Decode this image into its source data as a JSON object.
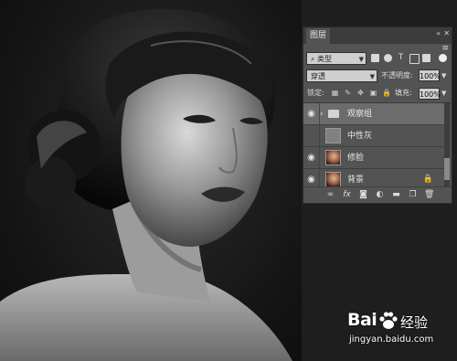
{
  "panel": {
    "tab_label": "图层",
    "collapse_control": "«",
    "close_control": "✕",
    "menu_icon": "≡",
    "filter": {
      "type_label": "类型",
      "search_glyph": "⌕"
    },
    "blend_mode": "穿透",
    "opacity_label": "不透明度:",
    "opacity_value": "100%",
    "lock_label": "锁定:",
    "fill_label": "填充:",
    "fill_value": "100%",
    "layers": [
      {
        "name": "观察组",
        "type": "group",
        "visible": true,
        "selected": true
      },
      {
        "name": "中性灰",
        "type": "gray-fill",
        "visible": false,
        "selected": false
      },
      {
        "name": "修脸",
        "type": "photo",
        "visible": true,
        "selected": false
      },
      {
        "name": "背景",
        "type": "photo",
        "visible": true,
        "selected": false,
        "locked": true
      }
    ],
    "bottom_icons": [
      "link-icon",
      "fx-icon",
      "mask-icon",
      "adjustment-icon",
      "folder-icon",
      "new-layer-icon",
      "trash-icon"
    ],
    "fx_label": "fx"
  },
  "watermark": {
    "logo_left": "Bai",
    "logo_right": "经验",
    "url": "jingyan.baidu.com"
  }
}
